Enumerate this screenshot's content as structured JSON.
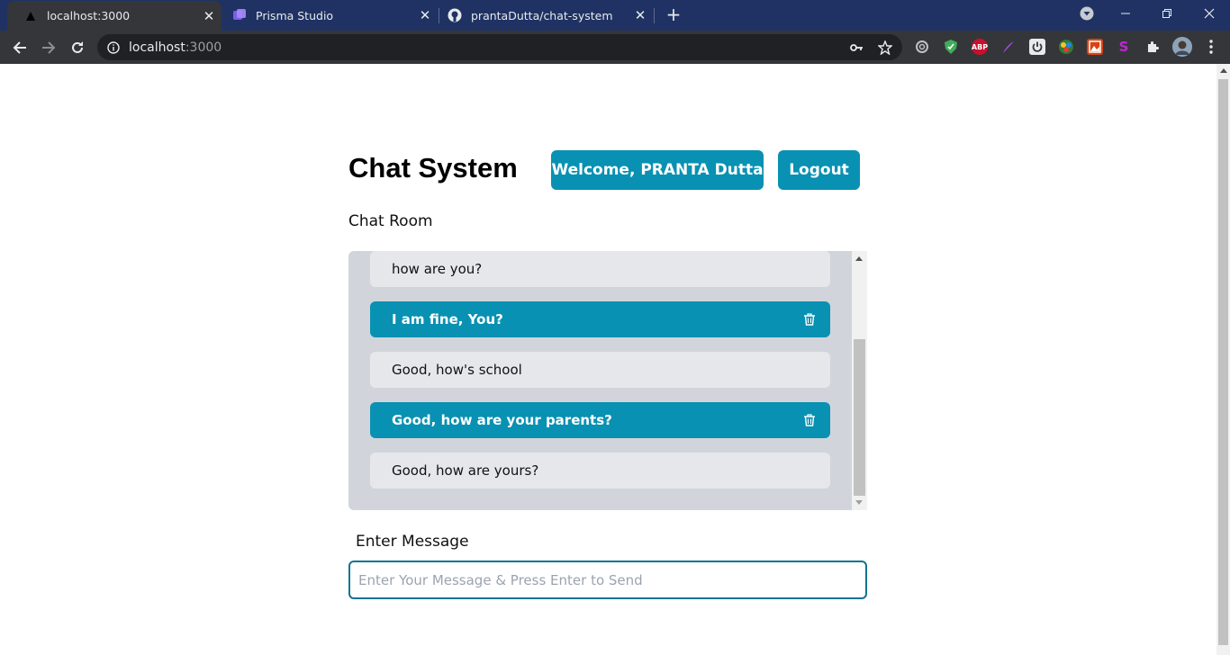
{
  "browser": {
    "tabs": [
      {
        "title": "localhost:3000",
        "active": true,
        "icon": "triangle-icon"
      },
      {
        "title": "Prisma Studio",
        "active": false,
        "icon": "prisma-icon"
      },
      {
        "title": "prantaDutta/chat-system",
        "active": false,
        "icon": "github-icon"
      }
    ],
    "address": {
      "host": "localhost",
      "port": ":3000"
    }
  },
  "header": {
    "title": "Chat System",
    "welcome": "Welcome, PRANTA Dutta",
    "logout": "Logout"
  },
  "chat": {
    "room_label": "Chat Room",
    "messages": [
      {
        "text": "how are you?",
        "mine": false
      },
      {
        "text": "I am fine, You?",
        "mine": true
      },
      {
        "text": "Good, how's school",
        "mine": false
      },
      {
        "text": "Good, how are your parents?",
        "mine": true
      },
      {
        "text": "Good, how are yours?",
        "mine": false
      }
    ]
  },
  "composer": {
    "label": "Enter Message",
    "placeholder": "Enter Your Message & Press Enter to Send",
    "value": ""
  },
  "colors": {
    "accent": "#0891b2",
    "chat_bg": "#d1d5db",
    "bubble_other": "#e5e7eb",
    "tabbar": "#1f3263"
  }
}
